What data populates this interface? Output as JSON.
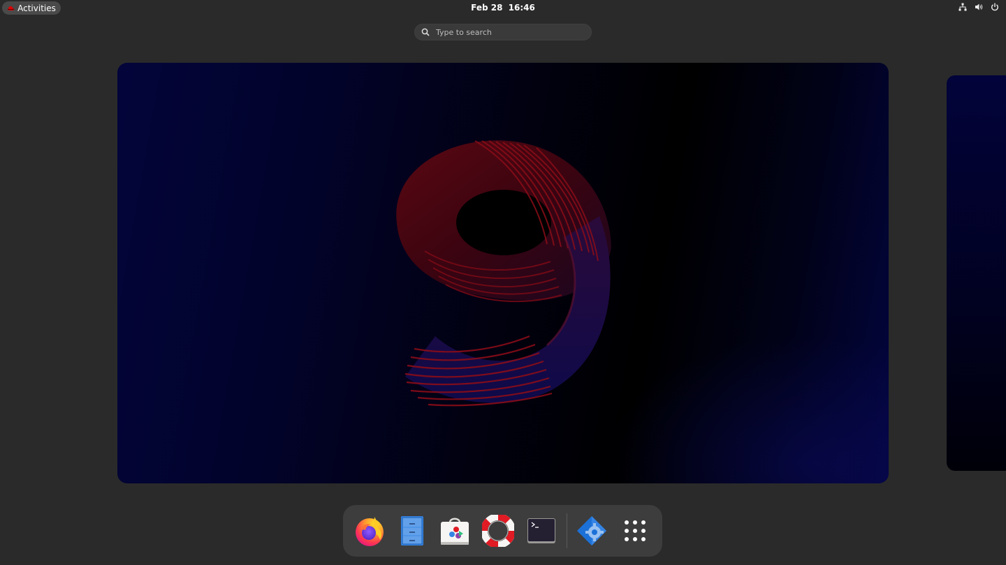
{
  "topbar": {
    "activities_label": "Activities",
    "date": "Feb 28",
    "time": "16:46",
    "tray_icons": [
      "network-icon",
      "volume-icon",
      "power-icon"
    ]
  },
  "search": {
    "placeholder": "Type to search"
  },
  "workspace": {
    "wallpaper": "nine-wallpaper",
    "accent_red": "#c0101e",
    "accent_blue": "#1a1a8a"
  },
  "dash": {
    "apps": [
      {
        "name": "firefox",
        "icon": "firefox-icon"
      },
      {
        "name": "files",
        "icon": "files-icon"
      },
      {
        "name": "software",
        "icon": "software-icon"
      },
      {
        "name": "help",
        "icon": "help-icon"
      },
      {
        "name": "terminal",
        "icon": "terminal-icon"
      },
      {
        "name": "settings",
        "icon": "settings-icon"
      },
      {
        "name": "app-grid",
        "icon": "app-grid-icon"
      }
    ]
  },
  "colors": {
    "background": "#2a2a2a",
    "dash_bg": "#3d3d3d",
    "search_bg": "#3a3a3a",
    "activities_bg": "#4a4a4a"
  }
}
